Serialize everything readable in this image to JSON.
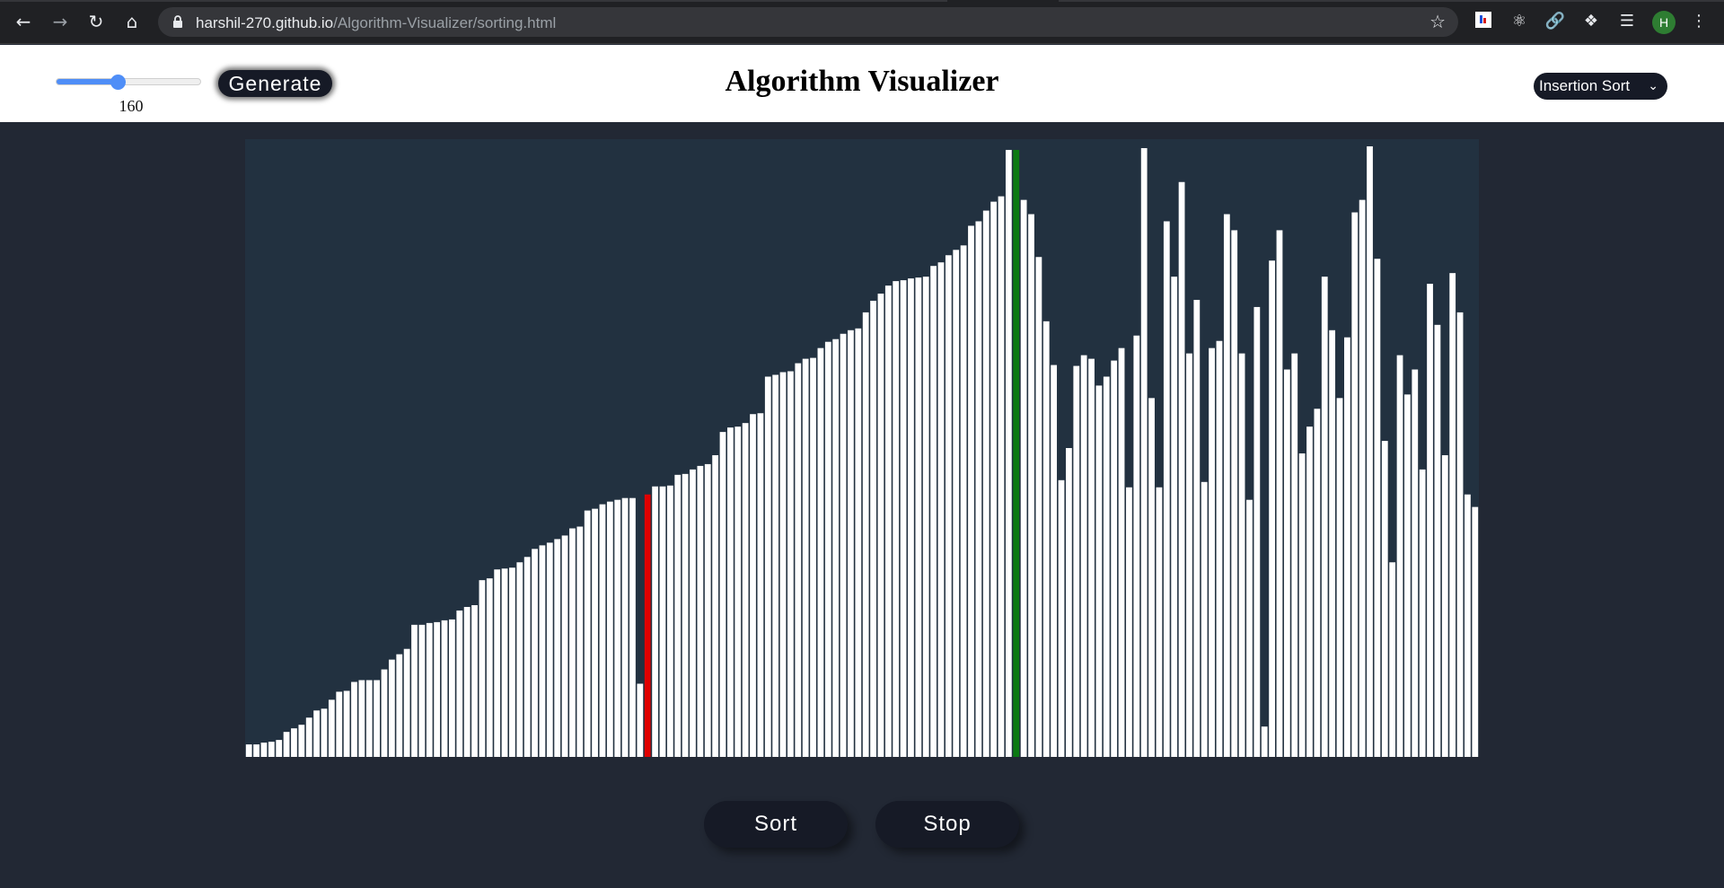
{
  "browser": {
    "url_host": "harshil-270.github.io",
    "url_path": "/Algorithm-Visualizer/sorting.html",
    "avatar_initial": "H",
    "icons": [
      "back-icon",
      "forward-icon",
      "reload-icon",
      "home-icon",
      "lock-icon",
      "star-icon",
      "extension-icon",
      "puzzle-icon",
      "media-icon",
      "menu-icon"
    ]
  },
  "header": {
    "title": "Algorithm Visualizer",
    "generate_label": "Generate",
    "size_value": "160",
    "size_fraction": 0.42,
    "algorithm_selected": "Insertion Sort"
  },
  "controls": {
    "sort_label": "Sort",
    "stop_label": "Stop"
  },
  "colors": {
    "bar": "#ffffff",
    "bar_compare": "#e00000",
    "bar_current": "#0b7a12",
    "area_bg": "#223140",
    "page_bg": "#222834"
  },
  "bars": {
    "max_value": 688,
    "compare_index": 53,
    "current_index": 102,
    "values": [
      14,
      14,
      16,
      17,
      19,
      28,
      32,
      36,
      44,
      52,
      54,
      64,
      73,
      74,
      84,
      86,
      86,
      86,
      98,
      109,
      115,
      121,
      148,
      148,
      150,
      151,
      153,
      154,
      164,
      168,
      170,
      198,
      200,
      210,
      211,
      212,
      218,
      224,
      233,
      237,
      240,
      244,
      248,
      256,
      258,
      276,
      278,
      283,
      286,
      288,
      290,
      290,
      82,
      294,
      303,
      303,
      304,
      316,
      317,
      322,
      326,
      328,
      338,
      364,
      369,
      370,
      374,
      384,
      385,
      426,
      428,
      431,
      432,
      441,
      446,
      447,
      458,
      465,
      468,
      474,
      478,
      480,
      498,
      511,
      519,
      528,
      533,
      534,
      536,
      537,
      538,
      550,
      554,
      562,
      568,
      573,
      595,
      600,
      612,
      622,
      628,
      680,
      680,
      624,
      608,
      560,
      488,
      439,
      310,
      346,
      438,
      450,
      446,
      416,
      426,
      444,
      458,
      302,
      472,
      682,
      402,
      302,
      600,
      538,
      644,
      452,
      512,
      308,
      458,
      466,
      608,
      590,
      452,
      288,
      504,
      34,
      556,
      590,
      434,
      452,
      340,
      370,
      390,
      538,
      478,
      402,
      470,
      610,
      624,
      684,
      558,
      354,
      218,
      450,
      406,
      434,
      322,
      530,
      484,
      338,
      542,
      498,
      294,
      280
    ],
    "raw_note": ""
  }
}
